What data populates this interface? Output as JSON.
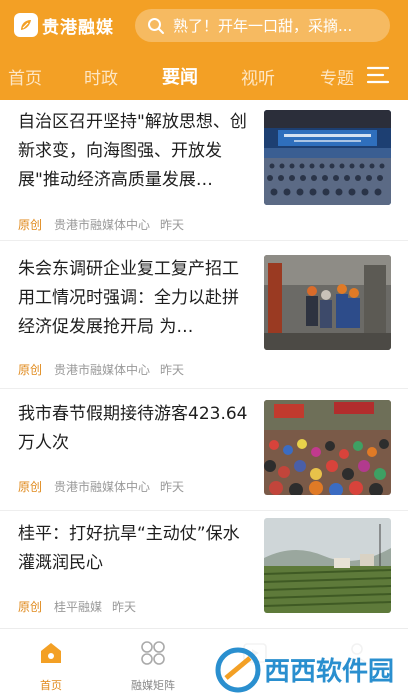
{
  "app": {
    "name": "贵港融媒",
    "brand_color": "#f3a025"
  },
  "search": {
    "placeholder": "熟了！开年一口甜，采摘..."
  },
  "tabs": [
    {
      "label": "首页",
      "active": false
    },
    {
      "label": "时政",
      "active": false
    },
    {
      "label": "要闻",
      "active": true
    },
    {
      "label": "视听",
      "active": false
    },
    {
      "label": "专题",
      "active": false
    }
  ],
  "articles": [
    {
      "title": "自治区召开坚持\"解放思想、创新求变，向海图强、开放发展\"推动经济高质量发展…",
      "tag": "原创",
      "source": "贵港市融媒体中心",
      "time": "昨天",
      "image": "conference-hall-photo"
    },
    {
      "title": "朱会东调研企业复工复产招工用工情况时强调：全力以赴拼经济促发展抢开局 为…",
      "tag": "原创",
      "source": "贵港市融媒体中心",
      "time": "昨天",
      "image": "factory-inspection-photo"
    },
    {
      "title": "我市春节假期接待游客423.64万人次",
      "tag": "原创",
      "source": "贵港市融媒体中心",
      "time": "昨天",
      "image": "festival-crowd-photo"
    },
    {
      "title": "桂平：打好抗旱“主动仗”保水灌溉润民心",
      "tag": "原创",
      "source": "桂平融媒",
      "time": "昨天",
      "image": "farm-field-photo"
    }
  ],
  "bottom_nav": [
    {
      "label": "首页",
      "icon": "home-icon",
      "active": true
    },
    {
      "label": "融媒矩阵",
      "icon": "grid-icon",
      "active": false
    },
    {
      "label": "",
      "icon": "play-icon",
      "active": false
    },
    {
      "label": "",
      "icon": "user-icon",
      "active": false
    }
  ],
  "watermark": {
    "text": "西西软件园"
  }
}
